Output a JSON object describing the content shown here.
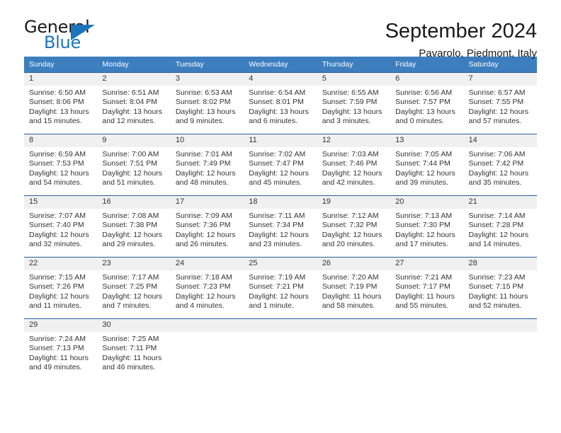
{
  "brand": {
    "name_top": "General",
    "name_bottom": "Blue",
    "triangle_color": "#1b75bb"
  },
  "header": {
    "title": "September 2024",
    "subtitle": "Pavarolo, Piedmont, Italy"
  },
  "theme": {
    "header_blue": "#3d7ebf",
    "row_border_blue": "#2a5d9e",
    "daynum_gray": "#f0f0f0",
    "text": "#333333"
  },
  "weekday_headers": [
    "Sunday",
    "Monday",
    "Tuesday",
    "Wednesday",
    "Thursday",
    "Friday",
    "Saturday"
  ],
  "weeks": [
    [
      {
        "day": "1",
        "sunrise": "Sunrise: 6:50 AM",
        "sunset": "Sunset: 8:06 PM",
        "daylight1": "Daylight: 13 hours",
        "daylight2": "and 15 minutes."
      },
      {
        "day": "2",
        "sunrise": "Sunrise: 6:51 AM",
        "sunset": "Sunset: 8:04 PM",
        "daylight1": "Daylight: 13 hours",
        "daylight2": "and 12 minutes."
      },
      {
        "day": "3",
        "sunrise": "Sunrise: 6:53 AM",
        "sunset": "Sunset: 8:02 PM",
        "daylight1": "Daylight: 13 hours",
        "daylight2": "and 9 minutes."
      },
      {
        "day": "4",
        "sunrise": "Sunrise: 6:54 AM",
        "sunset": "Sunset: 8:01 PM",
        "daylight1": "Daylight: 13 hours",
        "daylight2": "and 6 minutes."
      },
      {
        "day": "5",
        "sunrise": "Sunrise: 6:55 AM",
        "sunset": "Sunset: 7:59 PM",
        "daylight1": "Daylight: 13 hours",
        "daylight2": "and 3 minutes."
      },
      {
        "day": "6",
        "sunrise": "Sunrise: 6:56 AM",
        "sunset": "Sunset: 7:57 PM",
        "daylight1": "Daylight: 13 hours",
        "daylight2": "and 0 minutes."
      },
      {
        "day": "7",
        "sunrise": "Sunrise: 6:57 AM",
        "sunset": "Sunset: 7:55 PM",
        "daylight1": "Daylight: 12 hours",
        "daylight2": "and 57 minutes."
      }
    ],
    [
      {
        "day": "8",
        "sunrise": "Sunrise: 6:59 AM",
        "sunset": "Sunset: 7:53 PM",
        "daylight1": "Daylight: 12 hours",
        "daylight2": "and 54 minutes."
      },
      {
        "day": "9",
        "sunrise": "Sunrise: 7:00 AM",
        "sunset": "Sunset: 7:51 PM",
        "daylight1": "Daylight: 12 hours",
        "daylight2": "and 51 minutes."
      },
      {
        "day": "10",
        "sunrise": "Sunrise: 7:01 AM",
        "sunset": "Sunset: 7:49 PM",
        "daylight1": "Daylight: 12 hours",
        "daylight2": "and 48 minutes."
      },
      {
        "day": "11",
        "sunrise": "Sunrise: 7:02 AM",
        "sunset": "Sunset: 7:47 PM",
        "daylight1": "Daylight: 12 hours",
        "daylight2": "and 45 minutes."
      },
      {
        "day": "12",
        "sunrise": "Sunrise: 7:03 AM",
        "sunset": "Sunset: 7:46 PM",
        "daylight1": "Daylight: 12 hours",
        "daylight2": "and 42 minutes."
      },
      {
        "day": "13",
        "sunrise": "Sunrise: 7:05 AM",
        "sunset": "Sunset: 7:44 PM",
        "daylight1": "Daylight: 12 hours",
        "daylight2": "and 39 minutes."
      },
      {
        "day": "14",
        "sunrise": "Sunrise: 7:06 AM",
        "sunset": "Sunset: 7:42 PM",
        "daylight1": "Daylight: 12 hours",
        "daylight2": "and 35 minutes."
      }
    ],
    [
      {
        "day": "15",
        "sunrise": "Sunrise: 7:07 AM",
        "sunset": "Sunset: 7:40 PM",
        "daylight1": "Daylight: 12 hours",
        "daylight2": "and 32 minutes."
      },
      {
        "day": "16",
        "sunrise": "Sunrise: 7:08 AM",
        "sunset": "Sunset: 7:38 PM",
        "daylight1": "Daylight: 12 hours",
        "daylight2": "and 29 minutes."
      },
      {
        "day": "17",
        "sunrise": "Sunrise: 7:09 AM",
        "sunset": "Sunset: 7:36 PM",
        "daylight1": "Daylight: 12 hours",
        "daylight2": "and 26 minutes."
      },
      {
        "day": "18",
        "sunrise": "Sunrise: 7:11 AM",
        "sunset": "Sunset: 7:34 PM",
        "daylight1": "Daylight: 12 hours",
        "daylight2": "and 23 minutes."
      },
      {
        "day": "19",
        "sunrise": "Sunrise: 7:12 AM",
        "sunset": "Sunset: 7:32 PM",
        "daylight1": "Daylight: 12 hours",
        "daylight2": "and 20 minutes."
      },
      {
        "day": "20",
        "sunrise": "Sunrise: 7:13 AM",
        "sunset": "Sunset: 7:30 PM",
        "daylight1": "Daylight: 12 hours",
        "daylight2": "and 17 minutes."
      },
      {
        "day": "21",
        "sunrise": "Sunrise: 7:14 AM",
        "sunset": "Sunset: 7:28 PM",
        "daylight1": "Daylight: 12 hours",
        "daylight2": "and 14 minutes."
      }
    ],
    [
      {
        "day": "22",
        "sunrise": "Sunrise: 7:15 AM",
        "sunset": "Sunset: 7:26 PM",
        "daylight1": "Daylight: 12 hours",
        "daylight2": "and 11 minutes."
      },
      {
        "day": "23",
        "sunrise": "Sunrise: 7:17 AM",
        "sunset": "Sunset: 7:25 PM",
        "daylight1": "Daylight: 12 hours",
        "daylight2": "and 7 minutes."
      },
      {
        "day": "24",
        "sunrise": "Sunrise: 7:18 AM",
        "sunset": "Sunset: 7:23 PM",
        "daylight1": "Daylight: 12 hours",
        "daylight2": "and 4 minutes."
      },
      {
        "day": "25",
        "sunrise": "Sunrise: 7:19 AM",
        "sunset": "Sunset: 7:21 PM",
        "daylight1": "Daylight: 12 hours",
        "daylight2": "and 1 minute."
      },
      {
        "day": "26",
        "sunrise": "Sunrise: 7:20 AM",
        "sunset": "Sunset: 7:19 PM",
        "daylight1": "Daylight: 11 hours",
        "daylight2": "and 58 minutes."
      },
      {
        "day": "27",
        "sunrise": "Sunrise: 7:21 AM",
        "sunset": "Sunset: 7:17 PM",
        "daylight1": "Daylight: 11 hours",
        "daylight2": "and 55 minutes."
      },
      {
        "day": "28",
        "sunrise": "Sunrise: 7:23 AM",
        "sunset": "Sunset: 7:15 PM",
        "daylight1": "Daylight: 11 hours",
        "daylight2": "and 52 minutes."
      }
    ],
    [
      {
        "day": "29",
        "sunrise": "Sunrise: 7:24 AM",
        "sunset": "Sunset: 7:13 PM",
        "daylight1": "Daylight: 11 hours",
        "daylight2": "and 49 minutes."
      },
      {
        "day": "30",
        "sunrise": "Sunrise: 7:25 AM",
        "sunset": "Sunset: 7:11 PM",
        "daylight1": "Daylight: 11 hours",
        "daylight2": "and 46 minutes."
      },
      {
        "day": "",
        "sunrise": "",
        "sunset": "",
        "daylight1": "",
        "daylight2": ""
      },
      {
        "day": "",
        "sunrise": "",
        "sunset": "",
        "daylight1": "",
        "daylight2": ""
      },
      {
        "day": "",
        "sunrise": "",
        "sunset": "",
        "daylight1": "",
        "daylight2": ""
      },
      {
        "day": "",
        "sunrise": "",
        "sunset": "",
        "daylight1": "",
        "daylight2": ""
      },
      {
        "day": "",
        "sunrise": "",
        "sunset": "",
        "daylight1": "",
        "daylight2": ""
      }
    ]
  ]
}
